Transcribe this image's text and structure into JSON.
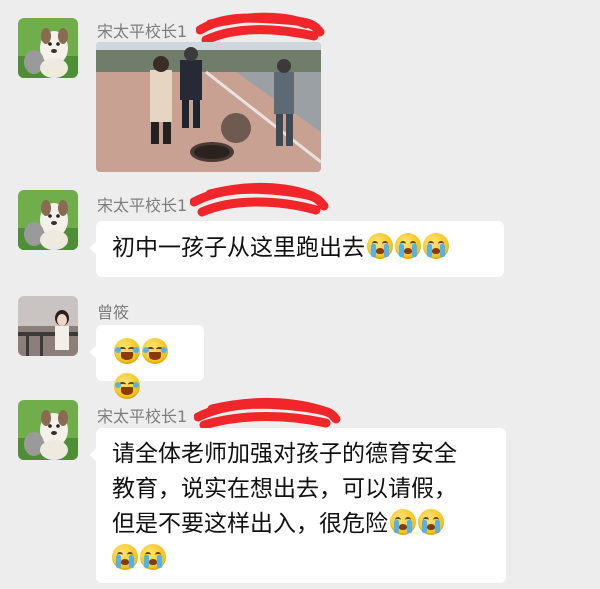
{
  "messages": [
    {
      "sender": "宋太平校长1",
      "type": "image",
      "image_alt": "photo of people next to an open manhole"
    },
    {
      "sender": "宋太平校长1",
      "type": "text",
      "text": "初中一孩子从这里跑出去",
      "emoji": [
        "crying-face",
        "crying-face",
        "crying-face"
      ]
    },
    {
      "sender": "曾筱",
      "type": "emoji",
      "emoji": [
        "laughing-tears-face",
        "laughing-tears-face",
        "laughing-tears-face"
      ]
    },
    {
      "sender": "宋太平校长1",
      "type": "text",
      "lines": [
        "请全体老师加强对孩子的德育安全",
        "教育，说实在想出去，可以请假，",
        "但是不要这样出入，很危险"
      ],
      "emoji": [
        "crying-face",
        "crying-face",
        "crying-face",
        "crying-face"
      ]
    }
  ],
  "colors": {
    "background": "#ededed",
    "bubble": "#ffffff",
    "sender": "#7d7d7d",
    "redaction": "#f0262a"
  }
}
